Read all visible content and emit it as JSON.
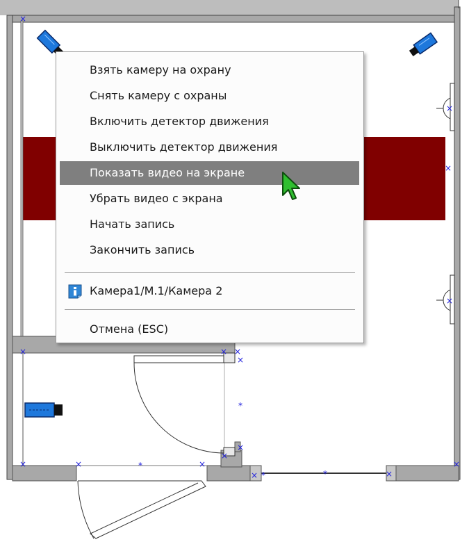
{
  "context_menu": {
    "items": [
      {
        "label": "Взять камеру на охрану"
      },
      {
        "label": "Снять камеру с охраны"
      },
      {
        "label": "Включить детектор движения"
      },
      {
        "label": "Выключить детектор движения"
      },
      {
        "label": "Показать видео на экране",
        "highlighted": true
      },
      {
        "label": "Убрать видео с экрана"
      },
      {
        "label": "Начать запись"
      },
      {
        "label": "Закончить запись"
      }
    ],
    "camera_path": "Камера1/М.1/Камера 2",
    "info_icon": "info-icon",
    "cancel_label": "Отмена (ESC)"
  },
  "colors": {
    "wall": "#a8a8a8",
    "zone": "#800000",
    "camera": "#1e78dc",
    "highlight": "#7f7f7f",
    "cursor": "#2fbf2f",
    "marker": "#2222dd"
  }
}
